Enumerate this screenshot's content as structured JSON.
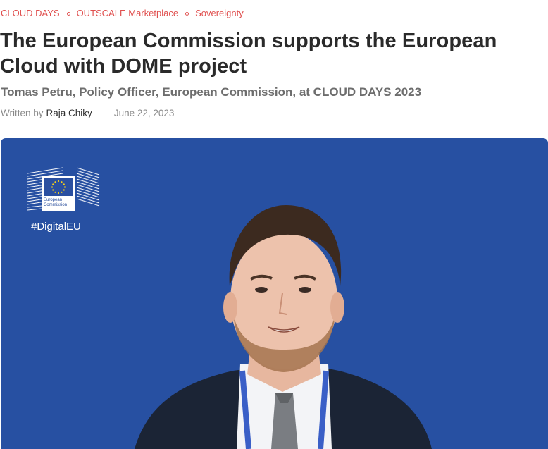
{
  "tags": [
    "CLOUD DAYS",
    "OUTSCALE Marketplace",
    "Sovereignty"
  ],
  "article": {
    "title_line1": "The European Commission supports the European",
    "title_line2": "Cloud with DOME project",
    "subtitle": "Tomas Petru, Policy Officer, European Commission, at CLOUD DAYS 2023",
    "written_by_label": "Written by",
    "author": "Raja Chiky",
    "date": "June 22, 2023"
  },
  "hero": {
    "logo_line1": "European",
    "logo_line2": "Commission",
    "hashtag": "#DigitalEU",
    "background_color": "#2750a2",
    "logo_star_color": "#f7d117"
  },
  "colors": {
    "accent": "#e0504f",
    "title": "#2a2a2a",
    "subtitle": "#6d6d6d"
  }
}
